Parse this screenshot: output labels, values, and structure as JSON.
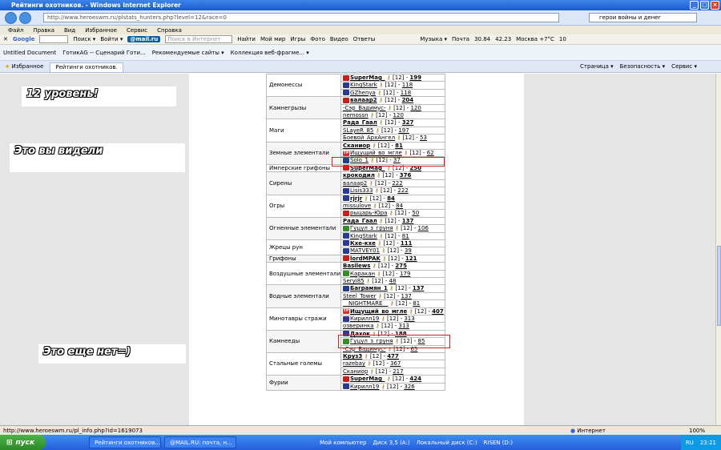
{
  "window": {
    "title": "Рейтинги охотников. - Windows Internet Explorer"
  },
  "address": {
    "url": "http://www.heroeswm.ru/plstats_hunters.php?level=12&race=0",
    "search": "герои войны и денег"
  },
  "menu": [
    "Файл",
    "Правка",
    "Вид",
    "Избранное",
    "Сервис",
    "Справка"
  ],
  "toolbar1": {
    "google": "Google",
    "search": "Поиск ▾",
    "login": "Войти ▾",
    "mailru": "@mail.ru",
    "search_placeholder": "Поиск в Интернет",
    "find": "Найти",
    "links": [
      "Мой мир",
      "Игры",
      "Фото",
      "Видео",
      "Ответы"
    ],
    "music": "Музыка ▾",
    "mail": "Почта",
    "v1": "30.84",
    "v2": "42.23",
    "weather": "Москва +7°C",
    "num": "10"
  },
  "links_bar": [
    "Untitled Document",
    "ГотикАG -- Сценарий Готи...",
    "Рекомендуемые сайты ▾",
    "Коллекция веб-фрагме... ▾"
  ],
  "tabs": {
    "favorites": "Избранное",
    "current": "Рейтинги охотников."
  },
  "cmdbar": [
    "Страница ▾",
    "Безопасность ▾",
    "Сервис ▾"
  ],
  "notes": [
    "12 уровень!",
    "Это вы видели",
    "Это еще нет=)"
  ],
  "factions": [
    {
      "name": "Демонессы",
      "players": [
        {
          "nick": "SuperMag_",
          "lvl": "[12] -",
          "score": "199",
          "icon": "red",
          "bold": true
        },
        {
          "nick": "KingStark",
          "lvl": "[12] -",
          "score": "118",
          "icon": "blue",
          "bold": false
        },
        {
          "nick": "GZhenya",
          "lvl": "[12] -",
          "score": "118",
          "icon": "blue",
          "bold": false
        }
      ]
    },
    {
      "name": "Камнегрызы",
      "players": [
        {
          "nick": "валаар2",
          "lvl": "[12] -",
          "score": "204",
          "icon": "red",
          "bold": true
        },
        {
          "nick": "-Сэр_Вадимус-",
          "lvl": "[12] -",
          "score": "120",
          "icon": "none",
          "bold": false
        },
        {
          "nick": "nemossn",
          "lvl": "[12] -",
          "score": "120",
          "icon": "none",
          "bold": false
        }
      ]
    },
    {
      "name": "Маги",
      "players": [
        {
          "nick": "Рада_Гаал",
          "lvl": "[12] -",
          "score": "327",
          "icon": "none",
          "bold": true
        },
        {
          "nick": "SLayeR_85",
          "lvl": "[12] -",
          "score": "197",
          "icon": "none",
          "bold": false
        },
        {
          "nick": "Боевой_АрхАнгел",
          "lvl": "[12] -",
          "score": "53",
          "icon": "none",
          "bold": false
        }
      ]
    },
    {
      "name": "Земные элементали",
      "players": [
        {
          "nick": "Сканиор",
          "lvl": "[12] -",
          "score": "81",
          "icon": "none",
          "bold": true
        },
        {
          "nick": "Ищущий_во_мгле",
          "lvl": "[12] -",
          "score": "62",
          "icon": "tp",
          "bold": false
        },
        {
          "nick": "Solo_1",
          "lvl": "[12] -",
          "score": "37",
          "icon": "blue",
          "bold": false
        }
      ]
    },
    {
      "name": "Имперские грифоны",
      "players": [
        {
          "nick": "SuperMag_",
          "lvl": "[12] -",
          "score": "250",
          "icon": "red",
          "bold": true
        }
      ]
    },
    {
      "name": "Сирены",
      "players": [
        {
          "nick": "крокодил",
          "lvl": "[12] -",
          "score": "376",
          "icon": "none",
          "bold": true
        },
        {
          "nick": "валаар2",
          "lvl": "[12] -",
          "score": "222",
          "icon": "none",
          "bold": false
        },
        {
          "nick": "Lisis333",
          "lvl": "[12] -",
          "score": "222",
          "icon": "blue",
          "bold": false
        }
      ]
    },
    {
      "name": "Огры",
      "players": [
        {
          "nick": "rjrjr",
          "lvl": "[12] -",
          "score": "84",
          "icon": "blue",
          "bold": true
        },
        {
          "nick": "missulove",
          "lvl": "[12] -",
          "score": "84",
          "icon": "none",
          "bold": false
        },
        {
          "nick": "рыцарь-Юра",
          "lvl": "[12] -",
          "score": "50",
          "icon": "red",
          "bold": false
        }
      ]
    },
    {
      "name": "Огненные элементали",
      "players": [
        {
          "nick": "Рада_Гаал",
          "lvl": "[12] -",
          "score": "137",
          "icon": "none",
          "bold": true
        },
        {
          "nick": "Гуцул_з_груня",
          "lvl": "[12] -",
          "score": "106",
          "icon": "green",
          "bold": false
        },
        {
          "nick": "KingStark",
          "lvl": "[12] -",
          "score": "81",
          "icon": "blue",
          "bold": false
        }
      ]
    },
    {
      "name": "Жрецы рун",
      "players": [
        {
          "nick": "Кхе-кхе",
          "lvl": "[12] -",
          "score": "111",
          "icon": "blue",
          "bold": true
        },
        {
          "nick": "MATVEY01",
          "lvl": "[12] -",
          "score": "39",
          "icon": "blue",
          "bold": false
        }
      ]
    },
    {
      "name": "Грифоны",
      "players": [
        {
          "nick": "lordMPAK",
          "lvl": "[12] -",
          "score": "121",
          "icon": "red",
          "bold": true
        }
      ]
    },
    {
      "name": "Воздушные элементали",
      "players": [
        {
          "nick": "Basilews",
          "lvl": "[12] -",
          "score": "275",
          "icon": "none",
          "bold": true
        },
        {
          "nick": "Каракан",
          "lvl": "[12] -",
          "score": "179",
          "icon": "green",
          "bold": false
        },
        {
          "nick": "Seryi85",
          "lvl": "[12] -",
          "score": "48",
          "icon": "none",
          "bold": false
        }
      ]
    },
    {
      "name": "Водные элементали",
      "players": [
        {
          "nick": "Баграмян_1",
          "lvl": "[12] -",
          "score": "137",
          "icon": "blue",
          "bold": true
        },
        {
          "nick": "Steel_Tower",
          "lvl": "[12] -",
          "score": "137",
          "icon": "none",
          "bold": false
        },
        {
          "nick": "__NIGHTMARE__",
          "lvl": "[12] -",
          "score": "81",
          "icon": "none",
          "bold": false
        }
      ]
    },
    {
      "name": "Минотавры стражи",
      "players": [
        {
          "nick": "Ищущий_во_мгле",
          "lvl": "[12] -",
          "score": "407",
          "icon": "tp",
          "bold": true
        },
        {
          "nick": "Кирилл19",
          "lvl": "[12] -",
          "score": "313",
          "icon": "blue",
          "bold": false
        },
        {
          "nick": "озверинка",
          "lvl": "[12] -",
          "score": "313",
          "icon": "none",
          "bold": false
        }
      ]
    },
    {
      "name": "Камнееды",
      "players": [
        {
          "nick": "Дахок",
          "lvl": "[12] -",
          "score": "188",
          "icon": "blue",
          "bold": true
        },
        {
          "nick": "Гуцул_з_груня",
          "lvl": "[12] -",
          "score": "85",
          "icon": "green",
          "bold": false
        },
        {
          "nick": "-Сэр_Вадимус-",
          "lvl": "[12] -",
          "score": "65",
          "icon": "none",
          "bold": false
        }
      ]
    },
    {
      "name": "Стальные големы",
      "players": [
        {
          "nick": "Круз3",
          "lvl": "[12] -",
          "score": "477",
          "icon": "none",
          "bold": true
        },
        {
          "nick": "razebay",
          "lvl": "[12] -",
          "score": "367",
          "icon": "none",
          "bold": false
        },
        {
          "nick": "Сканиор",
          "lvl": "[12] -",
          "score": "217",
          "icon": "none",
          "bold": false
        }
      ]
    },
    {
      "name": "Фурии",
      "players": [
        {
          "nick": "SuperMag_",
          "lvl": "[12] -",
          "score": "424",
          "icon": "red",
          "bold": true
        },
        {
          "nick": "Кирилл19",
          "lvl": "[12] -",
          "score": "326",
          "icon": "blue",
          "bold": false
        }
      ]
    }
  ],
  "status": {
    "url": "http://www.heroeswm.ru/pl_info.php?id=1619073",
    "zone": "Интернет",
    "zoom": "100%"
  },
  "taskbar": {
    "start": "пуск",
    "tasks": [
      "Рейтинги охотников...",
      "@MAIL.RU: почта, н..."
    ],
    "tray": [
      "Мой компьютер",
      "Диск 3,5 (A:)",
      "Локальный диск (C:)",
      "RISEN (D:)"
    ],
    "lang": "RU",
    "time": "23:21"
  },
  "colors": {
    "accent": "#1c58d0",
    "note_line": "#c0001a",
    "highlight": "#d02020"
  }
}
